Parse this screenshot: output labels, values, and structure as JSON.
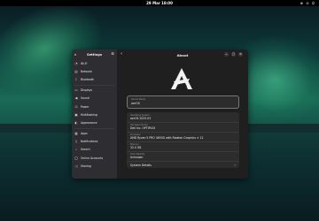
{
  "topbar": {
    "clock": "29 Mar 18:00",
    "status": "⊕ ⊙ ⏻"
  },
  "settings": {
    "title": "Settings"
  },
  "sidebar": {
    "items": [
      {
        "label": "Wi-Fi",
        "icon": "wifi-icon",
        "glyph": "◔"
      },
      {
        "label": "Network",
        "icon": "network-icon",
        "glyph": "▤"
      },
      {
        "label": "Bluetooth",
        "icon": "bluetooth-icon",
        "glyph": "ᛒ"
      },
      {
        "label": "Displays",
        "icon": "display-icon",
        "glyph": "▭"
      },
      {
        "label": "Sound",
        "icon": "sound-icon",
        "glyph": "◀"
      },
      {
        "label": "Power",
        "icon": "power-icon",
        "glyph": "⏻"
      },
      {
        "label": "Multitasking",
        "icon": "multitasking-icon",
        "glyph": "▣"
      },
      {
        "label": "Appearance",
        "icon": "appearance-icon",
        "glyph": "◐"
      },
      {
        "label": "Apps",
        "icon": "apps-icon",
        "glyph": "▦"
      },
      {
        "label": "Notifications",
        "icon": "bell-icon",
        "glyph": "◊"
      },
      {
        "label": "Search",
        "icon": "search-icon",
        "glyph": "⌕"
      },
      {
        "label": "Online Accounts",
        "icon": "accounts-icon",
        "glyph": "◯"
      },
      {
        "label": "Sharing",
        "icon": "sharing-icon",
        "glyph": "◁"
      }
    ]
  },
  "about": {
    "title": "About",
    "device_name_label": "Device Name",
    "device_name": "aerOS",
    "rows": [
      {
        "label": "Operating System",
        "value": "aerOS 2025.03"
      },
      {
        "label": "Hardware Model",
        "value": "Dell Inc. OPTIPLEX"
      },
      {
        "label": "Processor",
        "value": "AMD Ryzen 5 PRO 4650G with Radeon Graphics × 12"
      },
      {
        "label": "Memory",
        "value": "32.0 GB"
      },
      {
        "label": "Disk Capacity",
        "value": "Unknown"
      }
    ],
    "details_label": "System Details"
  }
}
